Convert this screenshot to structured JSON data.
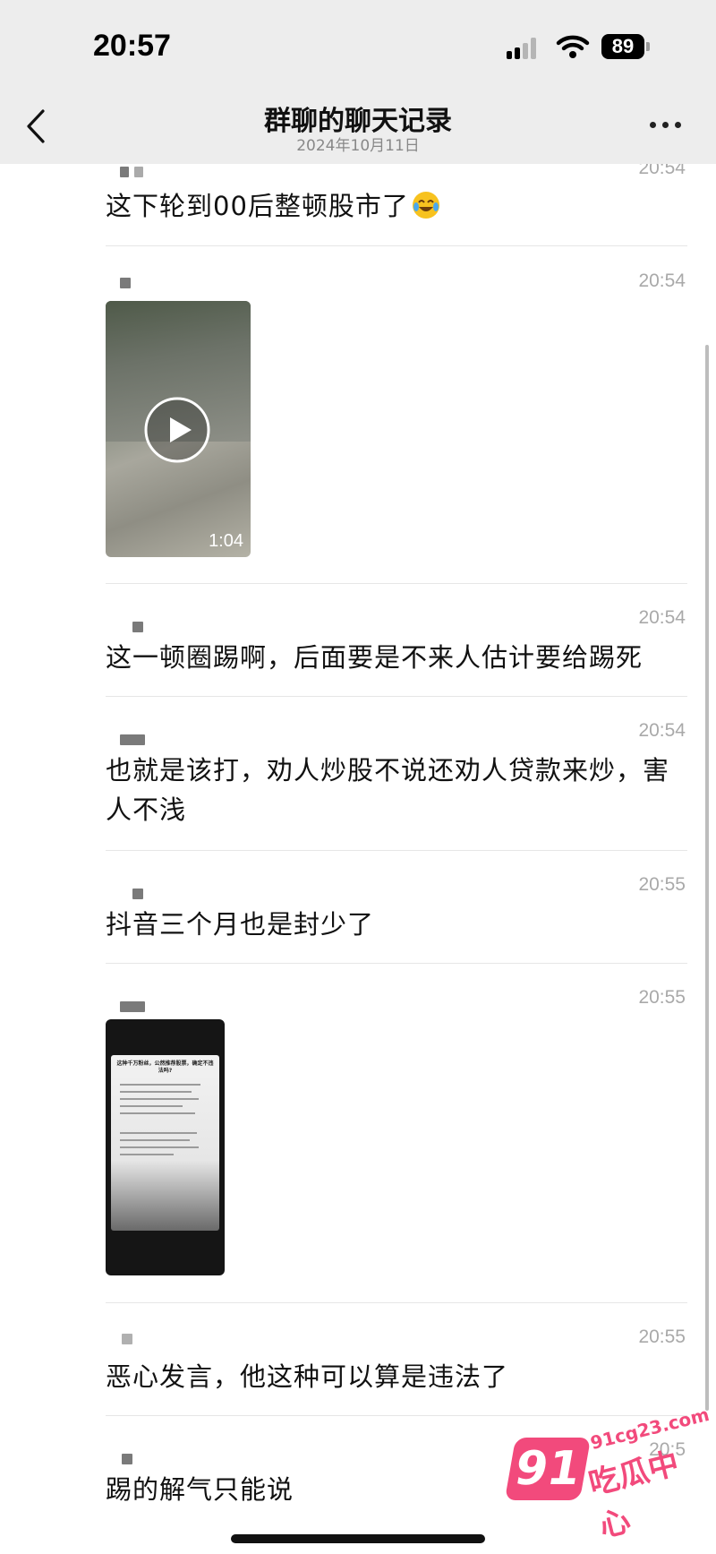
{
  "status_bar": {
    "time": "20:57",
    "battery": "89"
  },
  "header": {
    "title": "群聊的聊天记录",
    "subtitle": "2024年10月11日",
    "back_icon": "chevron-left-icon",
    "more_icon": "more-horizontal-icon"
  },
  "messages": [
    {
      "time": "20:54",
      "text": "这下轮到00后整顿股市了",
      "emoji": "laughing-crying-emoji"
    },
    {
      "time": "20:54",
      "type": "video",
      "duration": "1:04"
    },
    {
      "time": "20:54",
      "text": "这一顿圈踢啊，后面要是不来人估计要给踢死"
    },
    {
      "time": "20:54",
      "text": "也就是该打，劝人炒股不说还劝人贷款来炒，害人不浅"
    },
    {
      "time": "20:55",
      "text": "抖音三个月也是封少了"
    },
    {
      "time": "20:55",
      "type": "image",
      "caption": "这种千万粉丝，公然推荐股票，确定不违法吗?"
    },
    {
      "time": "20:55",
      "text": "恶心发言，他这种可以算是违法了"
    },
    {
      "time": "20:5",
      "text": "踢的解气只能说"
    }
  ],
  "watermark": {
    "logo": "91",
    "url": "91cg23.com",
    "name": "吃瓜中心"
  },
  "colors": {
    "header_bg": "#ededed",
    "time_gray": "#a9a9a9",
    "watermark_pink": "#f24a7c"
  }
}
